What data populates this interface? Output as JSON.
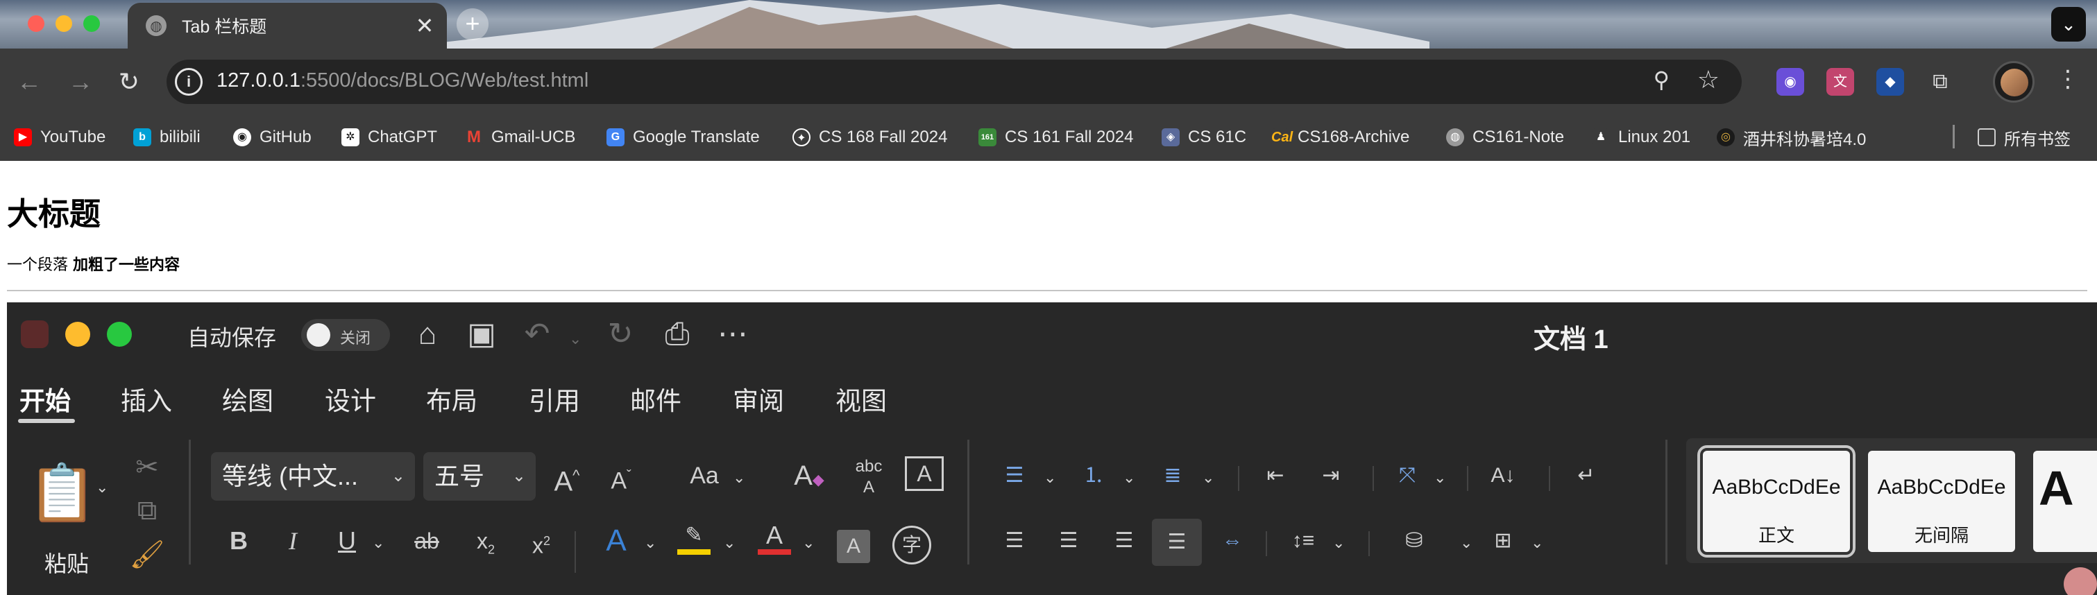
{
  "browser": {
    "tab": {
      "title": "Tab 栏标题",
      "close": "✕"
    },
    "new_tab": "+",
    "url": {
      "host": "127.0.0.1",
      "rest": ":5500/docs/BLOG/Web/test.html"
    },
    "bookmarks": [
      {
        "label": "YouTube",
        "icon": "youtube-icon",
        "color": "#ff0000"
      },
      {
        "label": "bilibili",
        "icon": "bilibili-icon",
        "color": "#00a1d6"
      },
      {
        "label": "GitHub",
        "icon": "github-icon",
        "color": "#ffffff"
      },
      {
        "label": "ChatGPT",
        "icon": "chatgpt-icon",
        "color": "#ffffff"
      },
      {
        "label": "Gmail-UCB",
        "icon": "gmail-icon",
        "color": "#ea4335"
      },
      {
        "label": "Google Translate",
        "icon": "google-translate-icon",
        "color": "#4285f4"
      },
      {
        "label": "CS 168 Fall 2024",
        "icon": "cs168-icon",
        "color": "#ffffff"
      },
      {
        "label": "CS 161 Fall 2024",
        "icon": "cs161-icon",
        "color": "#3a8a3a"
      },
      {
        "label": "CS 61C",
        "icon": "cs61c-icon",
        "color": "#5a6a9a"
      },
      {
        "label": "CS168-Archive",
        "icon": "cal-icon",
        "color": "#fdb515"
      },
      {
        "label": "CS161-Note",
        "icon": "globe-icon",
        "color": "#9a9a9a"
      },
      {
        "label": "Linux 201",
        "icon": "linux-icon",
        "color": "#ffffff"
      },
      {
        "label": "酒井科协暑培4.0",
        "icon": "club-icon",
        "color": "#e0b040"
      }
    ],
    "all_bookmarks": "所有书签"
  },
  "page": {
    "heading": "大标题",
    "paragraph": "一个段落",
    "paragraph_bold": "加粗了一些内容"
  },
  "word": {
    "autosave_label": "自动保存",
    "autosave_state": "关闭",
    "doc_title": "文档 1",
    "tabs": [
      "开始",
      "插入",
      "绘图",
      "设计",
      "布局",
      "引用",
      "邮件",
      "审阅",
      "视图"
    ],
    "paste_label": "粘贴",
    "font_name": "等线 (中文...",
    "font_size": "五号",
    "styles": [
      {
        "preview": "AaBbCcDdEe",
        "name": "正文"
      },
      {
        "preview": "AaBbCcDdEe",
        "name": "无间隔"
      }
    ],
    "styles_overflow": "A",
    "colors": {
      "highlight": "#f5d000",
      "font_color": "#e03030",
      "accent_blue": "#3b82d6"
    }
  }
}
